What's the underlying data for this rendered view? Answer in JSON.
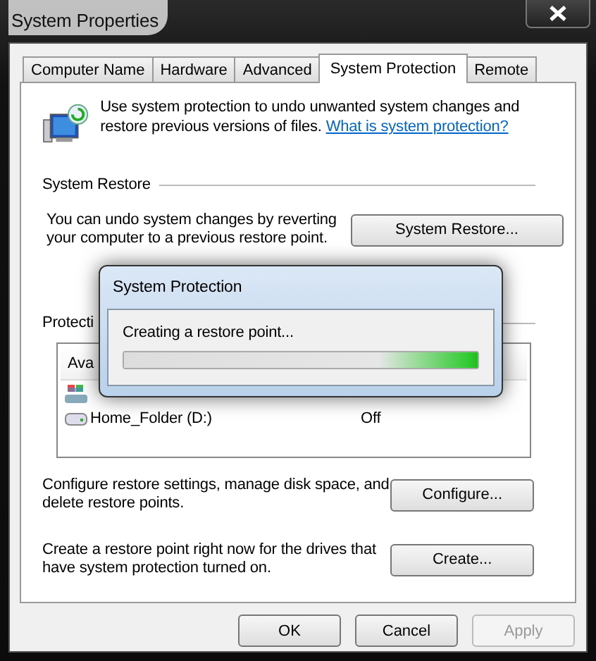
{
  "window": {
    "title": "System Properties"
  },
  "tabs": [
    {
      "label": "Computer Name",
      "selected": false
    },
    {
      "label": "Hardware",
      "selected": false
    },
    {
      "label": "Advanced",
      "selected": false
    },
    {
      "label": "System Protection",
      "selected": true
    },
    {
      "label": "Remote",
      "selected": false
    }
  ],
  "intro": {
    "text": "Use system protection to undo unwanted system changes and restore previous versions of files.",
    "link": "What is system protection?"
  },
  "system_restore": {
    "heading": "System Restore",
    "text": "You can undo system changes by reverting your computer to a previous restore point.",
    "button": "System Restore..."
  },
  "protection_settings": {
    "heading": "Protecti",
    "columns": [
      "Ava"
    ],
    "drives": [
      {
        "kind": "system"
      },
      {
        "kind": "disk",
        "name": "Home_Folder (D:)",
        "status": "Off"
      }
    ]
  },
  "configure": {
    "text": "Configure restore settings, manage disk space, and delete restore points.",
    "button": "Configure..."
  },
  "create": {
    "text": "Create a restore point right now for the drives that have system protection turned on.",
    "button": "Create..."
  },
  "buttons": [
    {
      "label": "OK",
      "disabled": false
    },
    {
      "label": "Cancel",
      "disabled": false
    },
    {
      "label": "Apply",
      "disabled": true
    }
  ],
  "dialog": {
    "title": "System Protection",
    "message": "Creating a restore point...",
    "level": 1
  }
}
